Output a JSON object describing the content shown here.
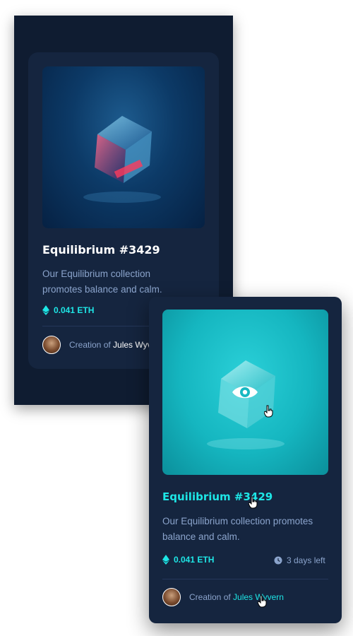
{
  "colors": {
    "frame": "#0f1c31",
    "card": "#15253f",
    "cyan": "#1ee6e6",
    "soft_blue": "#8ba4cc",
    "white": "#ffffff"
  },
  "background_card": {
    "title": "Equilibrium #3429",
    "description": "Our Equilibrium collection promotes balance and calm.",
    "price": "0.041 ETH",
    "creator_prefix": "Creation of",
    "creator_name": "Jules Wyvern"
  },
  "hover_card": {
    "title": "Equilibrium #3429",
    "description": "Our Equilibrium collection promotes balance and calm.",
    "price": "0.041 ETH",
    "time_left": "3 days left",
    "creator_prefix": "Creation of",
    "creator_name": "Jules Wyvern"
  },
  "icons": [
    "ethereum-icon",
    "clock-icon",
    "eye-icon",
    "hand-cursor-icon"
  ]
}
